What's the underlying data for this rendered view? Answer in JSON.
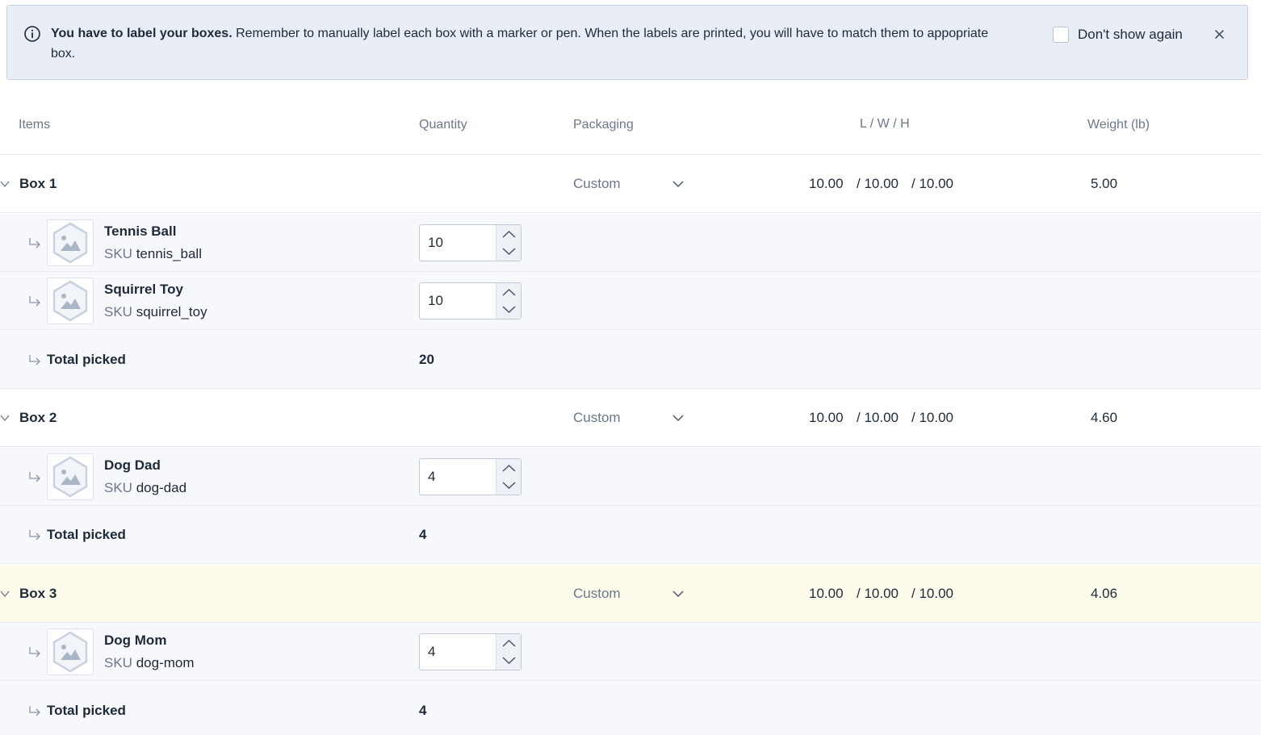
{
  "alert": {
    "title": "You have to label your boxes.",
    "body": "Remember to manually label each box with a marker or pen. When the labels are printed, you will have to match them to appopriate box.",
    "checkbox_label": "Don't show again"
  },
  "columns": {
    "items": "Items",
    "quantity": "Quantity",
    "packaging": "Packaging",
    "dims": "L / W / H",
    "weight": "Weight (lb)"
  },
  "sku_prefix": "SKU",
  "total_label": "Total picked",
  "boxes": [
    {
      "name": "Box 1",
      "packaging": "Custom",
      "length": "10.00",
      "width": "/ 10.00",
      "height": "/ 10.00",
      "weight": "5.00",
      "items": [
        {
          "name": "Tennis Ball",
          "sku": "tennis_ball",
          "qty": "10"
        },
        {
          "name": "Squirrel Toy",
          "sku": "squirrel_toy",
          "qty": "10"
        }
      ],
      "total": "20"
    },
    {
      "name": "Box 2",
      "packaging": "Custom",
      "length": "10.00",
      "width": "/ 10.00",
      "height": "/ 10.00",
      "weight": "4.60",
      "items": [
        {
          "name": "Dog Dad",
          "sku": "dog-dad",
          "qty": "4"
        }
      ],
      "total": "4"
    },
    {
      "name": "Box 3",
      "packaging": "Custom",
      "length": "10.00",
      "width": "/ 10.00",
      "height": "/ 10.00",
      "weight": "4.06",
      "items": [
        {
          "name": "Dog Mom",
          "sku": "dog-mom",
          "qty": "4"
        }
      ],
      "total": "4"
    }
  ]
}
